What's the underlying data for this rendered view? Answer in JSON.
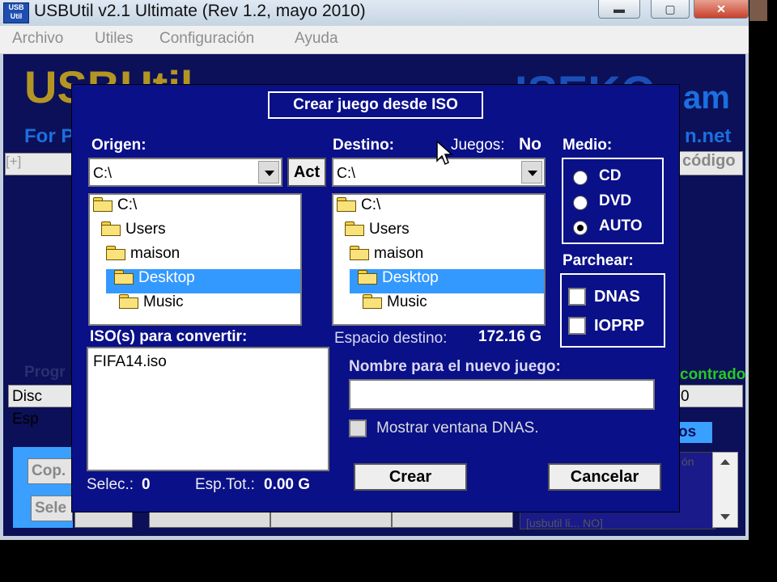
{
  "window": {
    "icon_text": "USB Util",
    "title": "USBUtil v2.1 Ultimate (Rev 1.2, mayo 2010)",
    "minimize_label": "▬",
    "maximize_label": "▢",
    "close_label": "✕"
  },
  "menu": [
    "Archivo",
    "Utiles",
    "Configuración",
    "Ayuda"
  ],
  "background": {
    "logo_left": "USBUtil",
    "logo_right": "ISEKO",
    "logo_right_end": "am",
    "subtitle_left": "For P",
    "subtitle_right": "n.net",
    "expand": "[+]",
    "codigo": "código",
    "prog": "Progr",
    "found": "contrado",
    "disc_field": "Disc Esp",
    "right_field": "0",
    "right_button": "os",
    "copy_button": "Cop.",
    "select_button": "Sele",
    "list_bottom": "[usbutil li... NO]",
    "list_top": "ón"
  },
  "dialog": {
    "title": "Crear juego desde ISO",
    "origin_label": "Origen:",
    "origin_path": "C:\\",
    "act_button": "Act",
    "origin_tree": [
      "C:\\",
      "Users",
      "maison",
      "Desktop",
      "Music"
    ],
    "dest_label": "Destino:",
    "games_label": "Juegos:",
    "games_value": "No",
    "dest_path": "C:\\",
    "dest_tree": [
      "C:\\",
      "Users",
      "maison",
      "Desktop",
      "Music"
    ],
    "medio_label": "Medio:",
    "media_options": [
      "CD",
      "DVD",
      "AUTO"
    ],
    "media_selected": "AUTO",
    "patch_label": "Parchear:",
    "patch_options": [
      "DNAS",
      "IOPRP"
    ],
    "iso_label": "ISO(s) para convertir:",
    "iso_list": [
      "FIFA14.iso"
    ],
    "dest_space_label": "Espacio destino:",
    "dest_space_value": "172.16 G",
    "new_name_label": "Nombre para el nuevo juego:",
    "new_name_value": "",
    "show_dnas_label": "Mostrar ventana DNAS.",
    "selec_label": "Selec.:",
    "selec_value": "0",
    "esp_tot_label": "Esp.Tot.:",
    "esp_tot_value": "0.00 G",
    "create_button": "Crear",
    "cancel_button": "Cancelar"
  },
  "colors": {
    "dialog_bg": "#0a1088",
    "client_bg": "#0c1058",
    "selection": "#3399ff",
    "logo_gold": "#b39523",
    "found_green": "#22cc22"
  }
}
